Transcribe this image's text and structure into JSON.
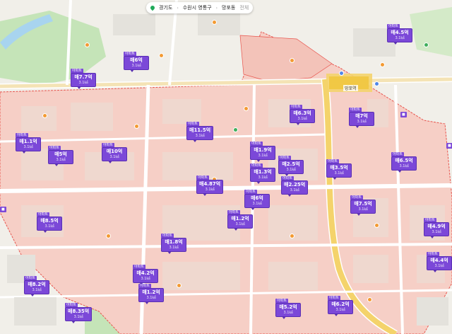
{
  "breadcrumb": {
    "province": "경기도",
    "city": "수원시 영통구",
    "dong": "망포동",
    "more": "전체"
  },
  "station": {
    "name": "망포역"
  },
  "colors": {
    "accent": "#7b48d8",
    "region_fill": "#f6cfc6",
    "region_border": "#e8554e",
    "park": "#c5e4b8",
    "road_major": "#f4d36b"
  },
  "markers": [
    {
      "price": "매4.5억",
      "sub": "3.1㎢"
    },
    {
      "price": "매6억",
      "sub": "3.1㎢"
    },
    {
      "price": "매7.7억",
      "sub": "3.1㎢"
    },
    {
      "price": "매6.3억",
      "sub": "3.1㎢"
    },
    {
      "price": "매7억",
      "sub": "3.1㎢"
    },
    {
      "price": "매11.5억",
      "sub": "3.1㎢"
    },
    {
      "price": "매1.1억",
      "sub": "3.1㎢"
    },
    {
      "price": "매5억",
      "sub": "3.1㎢"
    },
    {
      "price": "매10억",
      "sub": "3.1㎢"
    },
    {
      "price": "매1.9억",
      "sub": "3.1㎢"
    },
    {
      "price": "매2.5억",
      "sub": "3.1㎢"
    },
    {
      "price": "매1.3억",
      "sub": "3.1㎢"
    },
    {
      "price": "매3.5억",
      "sub": "3.1㎢"
    },
    {
      "price": "매6.5억",
      "sub": "3.1㎢"
    },
    {
      "price": "매4.87억",
      "sub": "3.1㎢"
    },
    {
      "price": "매2.25억",
      "sub": "3.1㎢"
    },
    {
      "price": "매6억",
      "sub": "3.1㎢"
    },
    {
      "price": "매7.5억",
      "sub": "3.1㎢"
    },
    {
      "price": "매8.5억",
      "sub": "3.1㎢"
    },
    {
      "price": "매1.2억",
      "sub": "3.1㎢"
    },
    {
      "price": "매4.9억",
      "sub": "3.1㎢"
    },
    {
      "price": "매1.8억",
      "sub": "3.1㎢"
    },
    {
      "price": "매4.2억",
      "sub": "3.1㎢"
    },
    {
      "price": "매4.4억",
      "sub": "3.1㎢"
    },
    {
      "price": "매8.2억",
      "sub": "3.1㎢"
    },
    {
      "price": "매1.2억",
      "sub": "3.1㎢"
    },
    {
      "price": "매5.2억",
      "sub": "3.1㎢"
    },
    {
      "price": "매6.2억",
      "sub": "3.1㎢"
    },
    {
      "price": "매8.35억",
      "sub": "3.1㎢"
    }
  ]
}
